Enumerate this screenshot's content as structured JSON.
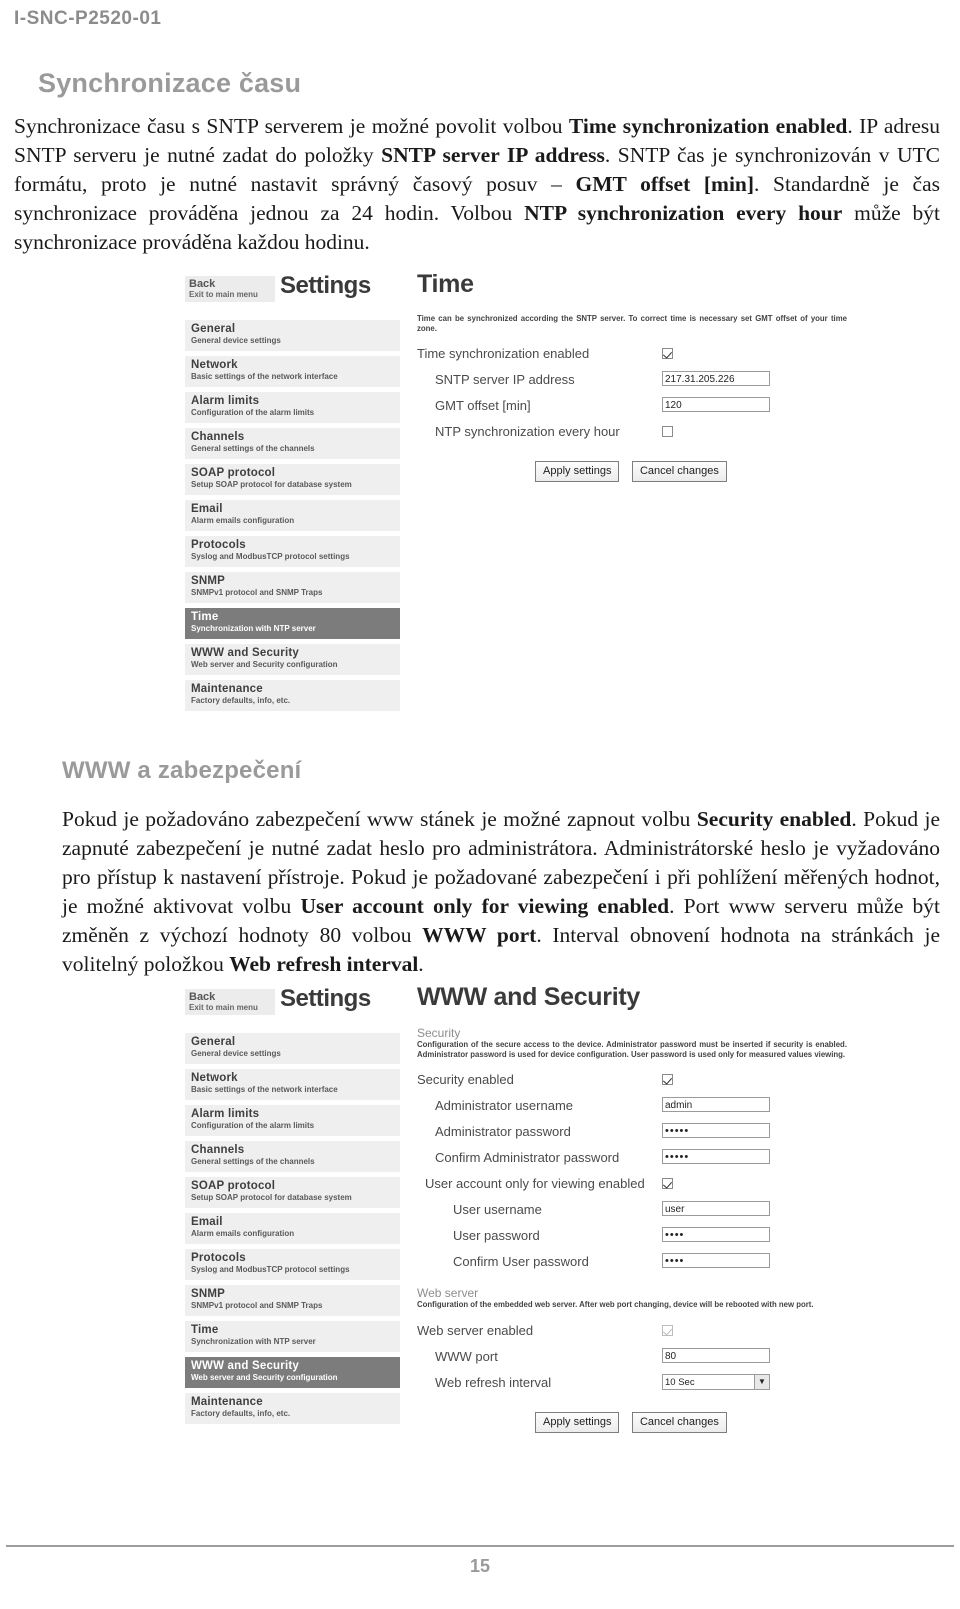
{
  "document": {
    "header_code": "I-SNC-P2520-01",
    "page_number": "15"
  },
  "sections": [
    {
      "heading": "Synchronizace času",
      "paragraph_html": "Synchronizace času s SNTP serverem je možné povolit volbou <b>Time synchronization enabled</b>. IP adresu SNTP serveru je nutné zadat do položky <b>SNTP server IP address</b>. SNTP čas je synchronizován v UTC formátu, proto je nutné nastavit správný časový posuv – <b>GMT offset [min]</b>. Standardně je čas synchronizace prováděna jednou za 24 hodin. Volbou <b>NTP synchronization every hour</b> může být synchronizace prováděna každou hodinu."
    },
    {
      "heading": "WWW a zabezpečení",
      "paragraph_html": "Pokud je požadováno zabezpečení www stánek je možné zapnout volbu <b>Security enabled</b>. Pokud je zapnuté zabezpečení je nutné zadat heslo pro administrátora. Administrátorské heslo je vyžadováno pro přístup k nastavení přístroje. Pokud je požadované zabezpečení i při pohlížení měřených hodnot, je možné aktivovat volbu <b>User account only for viewing enabled</b>. Port www serveru může být změněn z výchozí hodnoty 80 volbou <b>WWW port</b>. Interval obnovení hodnota na stránkách je volitelný položkou <b>Web refresh interval</b>."
    }
  ],
  "screenshot_time": {
    "back_button": {
      "title": "Back",
      "subtitle": "Exit to main menu"
    },
    "settings_word": "Settings",
    "panel_title": "Time",
    "menu": [
      {
        "title": "General",
        "subtitle": "General device settings",
        "active": false
      },
      {
        "title": "Network",
        "subtitle": "Basic settings of the network interface",
        "active": false
      },
      {
        "title": "Alarm limits",
        "subtitle": "Configuration of the alarm limits",
        "active": false
      },
      {
        "title": "Channels",
        "subtitle": "General settings of the channels",
        "active": false
      },
      {
        "title": "SOAP protocol",
        "subtitle": "Setup SOAP protocol for database system",
        "active": false
      },
      {
        "title": "Email",
        "subtitle": "Alarm emails configuration",
        "active": false
      },
      {
        "title": "Protocols",
        "subtitle": "Syslog and ModbusTCP protocol settings",
        "active": false
      },
      {
        "title": "SNMP",
        "subtitle": "SNMPv1 protocol and SNMP Traps",
        "active": false
      },
      {
        "title": "Time",
        "subtitle": "Synchronization with NTP server",
        "active": true
      },
      {
        "title": "WWW and Security",
        "subtitle": "Web server and Security configuration",
        "active": false
      },
      {
        "title": "Maintenance",
        "subtitle": "Factory defaults, info, etc.",
        "active": false
      }
    ],
    "hint": "Time can be synchronized according the SNTP server. To correct time is necessary set GMT offset of your time zone.",
    "fields": {
      "time_sync_enabled_label": "Time synchronization enabled",
      "time_sync_enabled_value": true,
      "sntp_ip_label": "SNTP server IP address",
      "sntp_ip_value": "217.31.205.226",
      "gmt_offset_label": "GMT offset [min]",
      "gmt_offset_value": "120",
      "ntp_hourly_label": "NTP synchronization every hour",
      "ntp_hourly_value": false
    },
    "buttons": {
      "apply": "Apply settings",
      "cancel": "Cancel changes"
    }
  },
  "screenshot_www": {
    "back_button": {
      "title": "Back",
      "subtitle": "Exit to main menu"
    },
    "settings_word": "Settings",
    "panel_title": "WWW and Security",
    "menu": [
      {
        "title": "General",
        "subtitle": "General device settings",
        "active": false
      },
      {
        "title": "Network",
        "subtitle": "Basic settings of the network interface",
        "active": false
      },
      {
        "title": "Alarm limits",
        "subtitle": "Configuration of the alarm limits",
        "active": false
      },
      {
        "title": "Channels",
        "subtitle": "General settings of the channels",
        "active": false
      },
      {
        "title": "SOAP protocol",
        "subtitle": "Setup SOAP protocol for database system",
        "active": false
      },
      {
        "title": "Email",
        "subtitle": "Alarm emails configuration",
        "active": false
      },
      {
        "title": "Protocols",
        "subtitle": "Syslog and ModbusTCP protocol settings",
        "active": false
      },
      {
        "title": "SNMP",
        "subtitle": "SNMPv1 protocol and SNMP Traps",
        "active": false
      },
      {
        "title": "Time",
        "subtitle": "Synchronization with NTP server",
        "active": false
      },
      {
        "title": "WWW and Security",
        "subtitle": "Web server and Security configuration",
        "active": true
      },
      {
        "title": "Maintenance",
        "subtitle": "Factory defaults, info, etc.",
        "active": false
      }
    ],
    "security_group_label": "Security",
    "security_group_hint": "Configuration of the secure access to the device. Administrator password must be inserted if security is enabled. Administrator password is used for device configuration. User password is used only for measured values viewing.",
    "webserver_group_label": "Web server",
    "webserver_group_hint": "Configuration of the embedded web server. After web port changing, device will be rebooted with new port.",
    "fields": {
      "security_enabled_label": "Security enabled",
      "security_enabled_value": true,
      "admin_username_label": "Administrator username",
      "admin_username_value": "admin",
      "admin_password_label": "Administrator password",
      "admin_password_value": "•••••",
      "confirm_admin_password_label": "Confirm Administrator password",
      "confirm_admin_password_value": "•••••",
      "user_account_label": "User account only for viewing enabled",
      "user_account_value": true,
      "user_username_label": "User username",
      "user_username_value": "user",
      "user_password_label": "User password",
      "user_password_value": "••••",
      "confirm_user_password_label": "Confirm User password",
      "confirm_user_password_value": "••••",
      "web_server_enabled_label": "Web server enabled",
      "web_server_enabled_value": true,
      "www_port_label": "WWW port",
      "www_port_value": "80",
      "web_refresh_label": "Web refresh interval",
      "web_refresh_value": "10 Sec"
    },
    "buttons": {
      "apply": "Apply settings",
      "cancel": "Cancel changes"
    }
  },
  "colors": {
    "heading_gray": "#9a9a9a",
    "menu_bg": "#efefef",
    "menu_active_bg": "#7c7c7c",
    "text": "#1a1a1a"
  }
}
